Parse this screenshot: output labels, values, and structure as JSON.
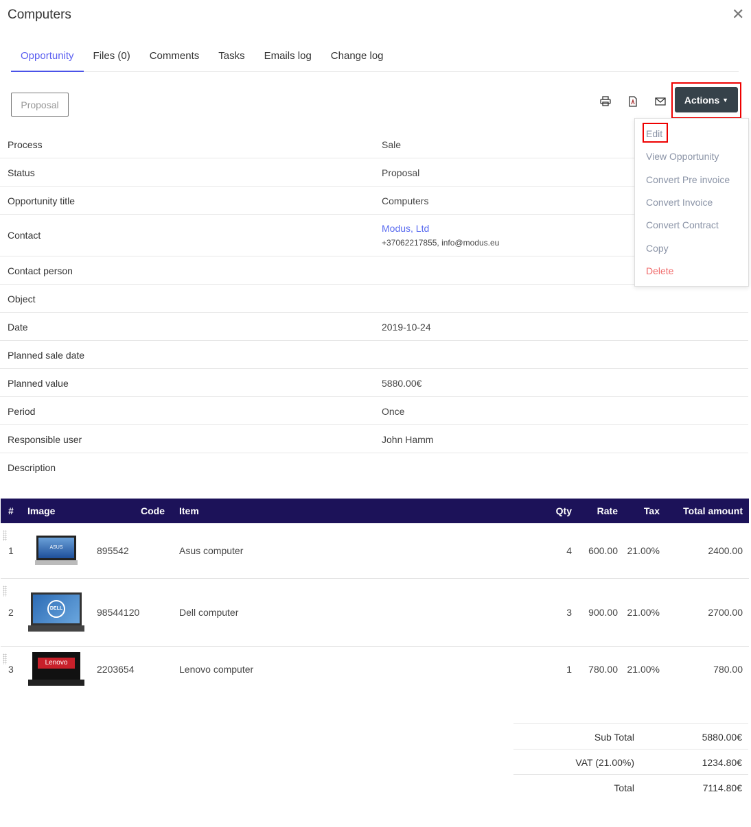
{
  "title": "Computers",
  "tabs": [
    "Opportunity",
    "Files (0)",
    "Comments",
    "Tasks",
    "Emails log",
    "Change log"
  ],
  "status_button": "Proposal",
  "actions_label": "Actions",
  "menu": [
    "Edit",
    "View Opportunity",
    "Convert Pre invoice",
    "Convert Invoice",
    "Convert Contract",
    "Copy",
    "Delete"
  ],
  "colors": {
    "accent": "#4a52e8",
    "header": "#1c1259",
    "delete": "#f06a6a",
    "link": "#5a6cf0"
  },
  "details": [
    {
      "label": "Process",
      "value": "Sale"
    },
    {
      "label": "Status",
      "value": "Proposal"
    },
    {
      "label": "Opportunity title",
      "value": "Computers"
    },
    {
      "label": "Contact",
      "value": "Modus, Ltd",
      "sub": "+37062217855, info@modus.eu"
    },
    {
      "label": "Contact person",
      "value": ""
    },
    {
      "label": "Object",
      "value": ""
    },
    {
      "label": "Date",
      "value": "2019-10-24"
    },
    {
      "label": "Planned sale date",
      "value": ""
    },
    {
      "label": "Planned value",
      "value": "5880.00€"
    },
    {
      "label": "Period",
      "value": "Once"
    },
    {
      "label": "Responsible user",
      "value": "John Hamm"
    },
    {
      "label": "Description",
      "value": ""
    }
  ],
  "table": {
    "headers": [
      "#",
      "Image",
      "Code",
      "Item",
      "Qty",
      "Rate",
      "Tax",
      "Total amount"
    ],
    "rows": [
      {
        "n": "1",
        "code": "895542",
        "item": "Asus computer",
        "qty": "4",
        "rate": "600.00",
        "tax": "21.00%",
        "total": "2400.00",
        "brand": "ASUS"
      },
      {
        "n": "2",
        "code": "98544120",
        "item": "Dell computer",
        "qty": "3",
        "rate": "900.00",
        "tax": "21.00%",
        "total": "2700.00",
        "brand": "DELL"
      },
      {
        "n": "3",
        "code": "2203654",
        "item": "Lenovo computer",
        "qty": "1",
        "rate": "780.00",
        "tax": "21.00%",
        "total": "780.00",
        "brand": "Lenovo"
      }
    ]
  },
  "totals": [
    {
      "label": "Sub Total",
      "value": "5880.00€"
    },
    {
      "label": "VAT (21.00%)",
      "value": "1234.80€"
    },
    {
      "label": "Total",
      "value": "7114.80€"
    }
  ]
}
